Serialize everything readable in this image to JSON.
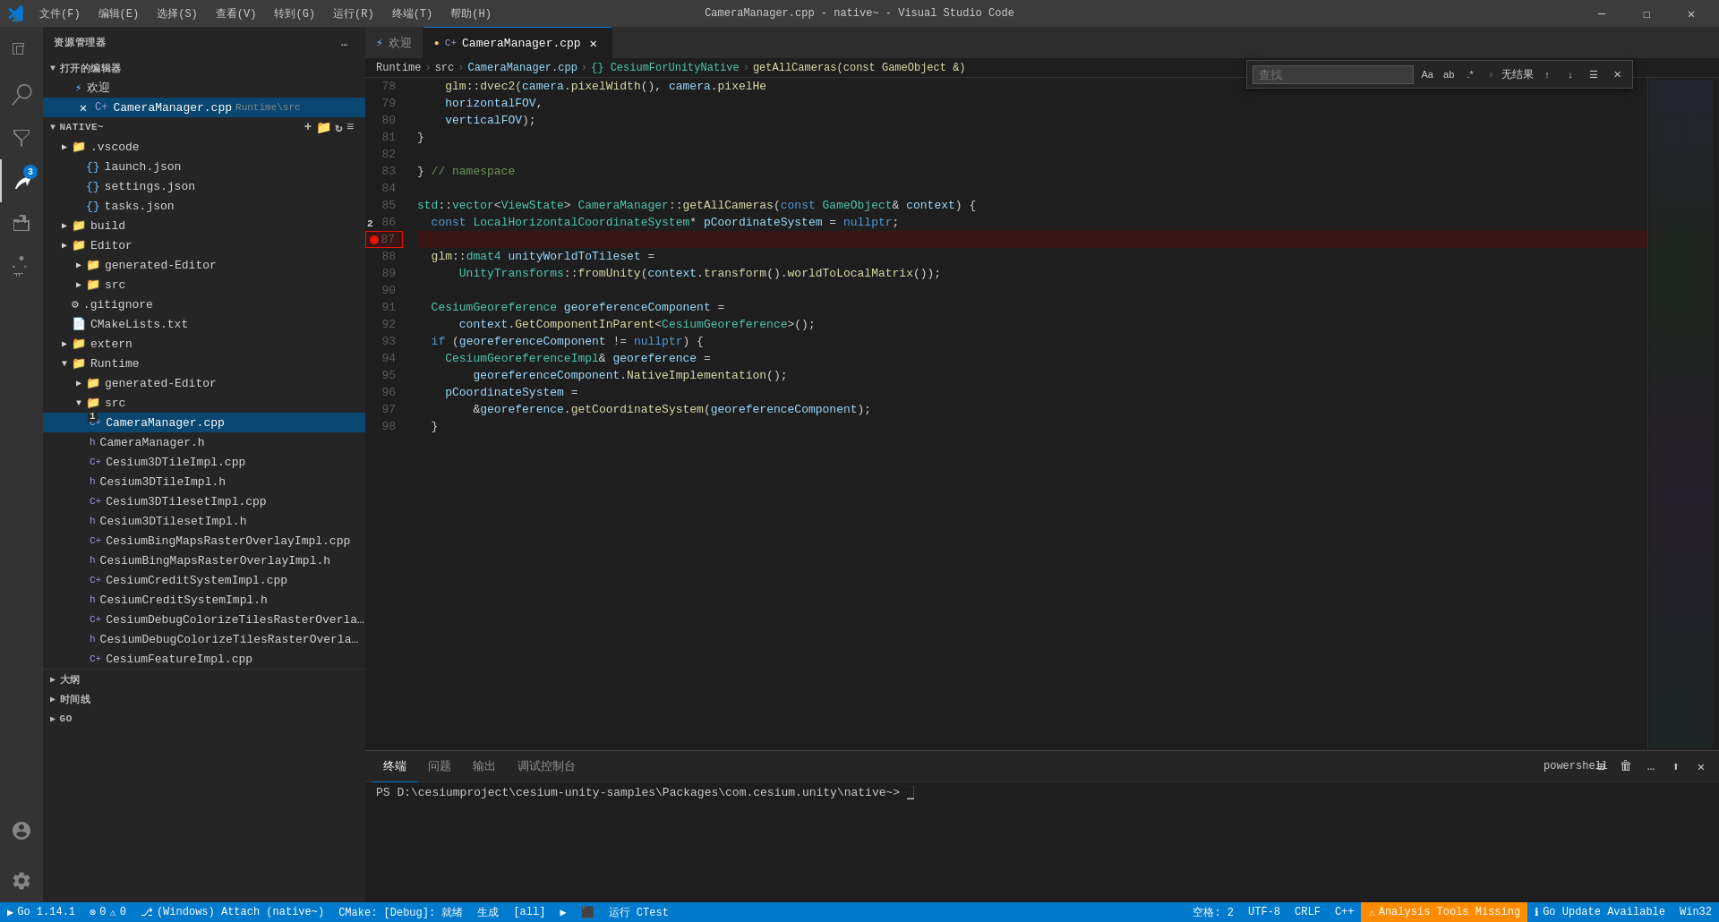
{
  "titlebar": {
    "title": "CameraManager.cpp - native~ - Visual Studio Code",
    "menu": [
      "文件(F)",
      "编辑(E)",
      "选择(S)",
      "查看(V)",
      "转到(G)",
      "运行(R)",
      "终端(T)",
      "帮助(H)"
    ]
  },
  "sidebar": {
    "title": "资源管理器",
    "open_editors_label": "打开的编辑器",
    "welcome_tab": "欢迎",
    "camera_manager_tab": "CameraManager.cpp",
    "native_label": "NATIVE~",
    "folders": {
      "vscode": ".vscode",
      "launch": "launch.json",
      "settings": "settings.json",
      "tasks": "tasks.json",
      "build": "build",
      "editor": "Editor",
      "generated_editor": "generated-Editor",
      "src": "src",
      "gitignore": ".gitignore",
      "cmake": "CMakeLists.txt",
      "extern": "extern",
      "runtime": "Runtime",
      "runtime_generated": "generated-Editor",
      "runtime_src": "src",
      "camera_manager_cpp": "CameraManager.cpp",
      "camera_manager_h": "CameraManager.h",
      "cesium3d_tile_impl_cpp": "Cesium3DTileImpl.cpp",
      "cesium3d_tile_impl_h": "Cesium3DTileImpl.h",
      "cesium3d_tileset_impl_cpp": "Cesium3DTilesetImpl.cpp",
      "cesium3d_tileset_impl_h": "Cesium3DTilesetImpl.h",
      "cesium_bing_raster_cpp": "CesiumBingMapsRasterOverlayImpl.cpp",
      "cesium_bing_raster_h": "CesiumBingMapsRasterOverlayImpl.h",
      "cesium_credit_cpp": "CesiumCreditSystemImpl.cpp",
      "cesium_credit_h": "CesiumCreditSystemImpl.h",
      "cesium_debug_cpp": "CesiumDebugColorizeTilesRasterOverlayImpl.cpp",
      "cesium_debug_h": "CesiumDebugColorizeTilesRasterOverlayImpl.h",
      "cesium_feature_cpp": "CesiumFeatureImpl.cpp"
    }
  },
  "breadcrumb": {
    "parts": [
      "Runtime",
      "src",
      "CameraManager.cpp",
      "{} CesiumForUnityNative",
      "getAllCameras(const GameObject &)"
    ]
  },
  "find_widget": {
    "placeholder": "查找",
    "no_result": "无结果",
    "options": [
      "Aa",
      "ab",
      ".*"
    ]
  },
  "code": {
    "lines": [
      {
        "num": 78,
        "content": "    glm::dvec2(camera.pixelWidth(), camera.pixelHe"
      },
      {
        "num": 79,
        "content": "    horizontalFOV,"
      },
      {
        "num": 80,
        "content": "    verticalFOV);"
      },
      {
        "num": 81,
        "content": "}"
      },
      {
        "num": 82,
        "content": ""
      },
      {
        "num": 83,
        "content": "} // namespace"
      },
      {
        "num": 84,
        "content": ""
      },
      {
        "num": 85,
        "content": "std::vector<ViewState> CameraManager::getAllCameras(const GameObject& context) {"
      },
      {
        "num": 86,
        "content": "  const LocalHorizontalCoordinateSystem* pCoordinateSystem = nullptr;",
        "debug": "2"
      },
      {
        "num": 87,
        "content": "",
        "breakpoint": true
      },
      {
        "num": 88,
        "content": "  glm::dmat4 unityWorldToTileset ="
      },
      {
        "num": 89,
        "content": "      UnityTransforms::fromUnity(context.transform().worldToLocalMatrix());"
      },
      {
        "num": 90,
        "content": ""
      },
      {
        "num": 91,
        "content": "  CesiumGeoreference georeferenceComponent ="
      },
      {
        "num": 92,
        "content": "      context.GetComponentInParent<CesiumGeoreference>();"
      },
      {
        "num": 93,
        "content": "  if (georeferenceComponent != nullptr) {"
      },
      {
        "num": 94,
        "content": "    CesiumGeoreferenceImpl& georeference ="
      },
      {
        "num": 95,
        "content": "        georeferenceComponent.NativeImplementation();"
      },
      {
        "num": 96,
        "content": "    pCoordinateSystem ="
      },
      {
        "num": 97,
        "content": "        &georeference.getCoordinateSystem(georeferenceComponent);"
      },
      {
        "num": 98,
        "content": "  }"
      }
    ]
  },
  "terminal": {
    "tabs": [
      "终端",
      "问题",
      "输出",
      "调试控制台"
    ],
    "active_tab": "终端",
    "prompt": "PS D:\\cesiumproject\\cesium-unity-samples\\Packages\\com.cesium.unity\\native~> ",
    "powershell_label": "powershell"
  },
  "statusbar": {
    "git_branch": "(Windows) Attach (native~)",
    "go_version": "Go 1.14.1",
    "errors": "0",
    "warnings": "0",
    "cmake": "CMake: [Debug]: 就绪",
    "build": "生成",
    "all": "[all]",
    "run_ctest": "运行 CTest",
    "spaces": "空格: 2",
    "encoding": "UTF-8",
    "line_ending": "CRLF",
    "language": "C++",
    "analysis_tools": "Analysis Tools Missing",
    "go_update": "Go Update Available",
    "win32": "Win32"
  }
}
